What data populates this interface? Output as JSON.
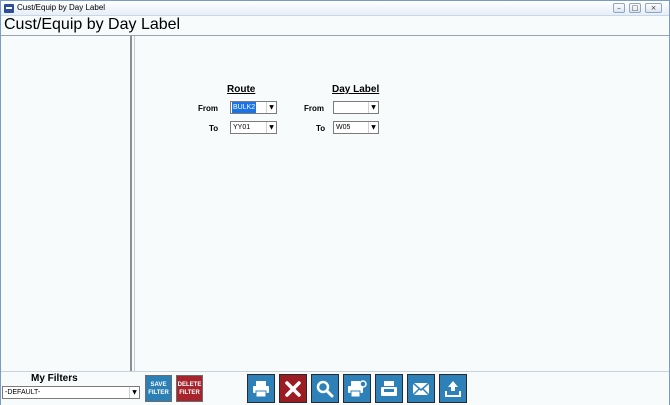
{
  "window": {
    "title": "Cust/Equip by Day Label"
  },
  "header": {
    "title": "Cust/Equip by Day Label"
  },
  "filters_form": {
    "route_heading": "Route",
    "day_label_heading": "Day Label",
    "from_label": "From",
    "to_label": "To",
    "route_from": "BULK2",
    "route_to": "YY01",
    "day_from": "",
    "day_to": "W05"
  },
  "my_filters": {
    "title": "My Filters",
    "selected": "-DEFAULT-",
    "save_line1": "SAVE",
    "save_line2": "FILTER",
    "delete_line1": "DELETE",
    "delete_line2": "FILTER"
  },
  "toolbar": {
    "icons": [
      "print-icon",
      "cancel-icon",
      "search-icon",
      "print-preview-icon",
      "fax-icon",
      "email-icon",
      "export-icon"
    ]
  },
  "colors": {
    "accent": "#2d80b8",
    "danger": "#9b1c22",
    "selection": "#1b73e8"
  }
}
